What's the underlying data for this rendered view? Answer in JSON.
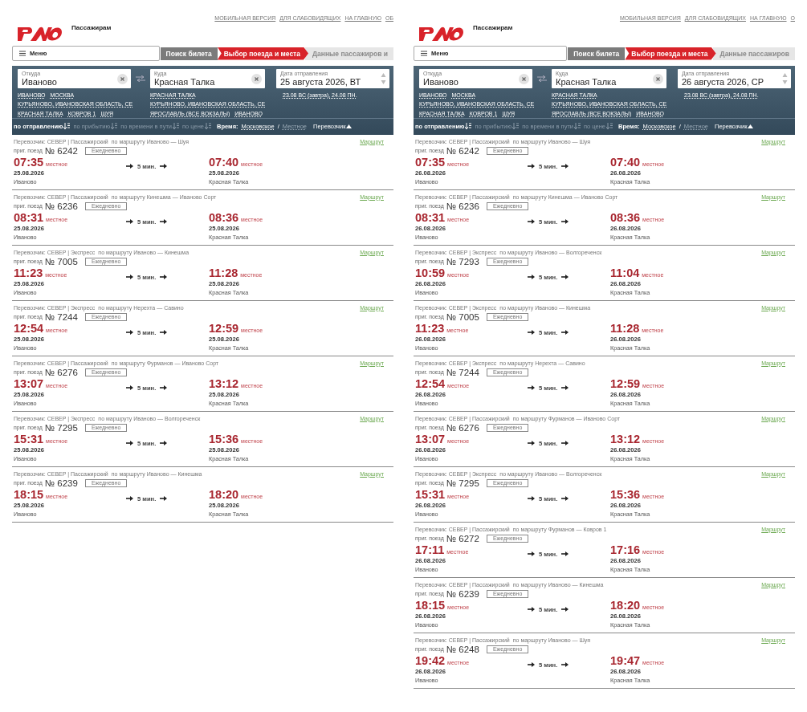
{
  "panels": [
    {
      "header": {
        "section": "Пассажирам",
        "top_links": [
          "МОБИЛЬНАЯ ВЕРСИЯ",
          "ДЛЯ СЛАБОВИДЯЩИХ",
          "НА ГЛАВНУЮ",
          "ОБ"
        ],
        "menu": "Меню",
        "steps": [
          {
            "label": "Поиск билета",
            "completed": true,
            "selected": false
          },
          {
            "label": "Выбор поезда и места",
            "completed": false,
            "selected": true
          },
          {
            "label": "Данные пассажиров и",
            "completed": false,
            "selected": false
          }
        ]
      },
      "search": {
        "from": {
          "label": "Откуда",
          "value": "Иваново"
        },
        "to": {
          "label": "Куда",
          "value": "Красная Талка"
        },
        "date": {
          "label": "Дата отправления",
          "value": "25 августа 2026, ВТ"
        },
        "from_suggestions": [
          "ИВАНОВО",
          "МОСКВА",
          "КУРЬЯНОВО, ИВАНОВСКАЯ ОБЛАСТЬ, СЕ",
          "КРАСНАЯ ТАЛКА",
          "КОВРОВ 1",
          "ШУЯ"
        ],
        "to_suggestions": [
          "КРАСНАЯ ТАЛКА",
          "КУРЬЯНОВО, ИВАНОВСКАЯ ОБЛАСТЬ, СЕ",
          "ЯРОСЛАВЛЬ (ВСЕ ВОКЗАЛЫ)",
          "ИВАНОВО"
        ],
        "date_shortcuts": "23.08 ВС (завтра), 24.08 ПН."
      },
      "sort": {
        "options": [
          {
            "label": "по отправлению",
            "selected": true
          },
          {
            "label": "по прибытию",
            "selected": false
          },
          {
            "label": "по времени в пути",
            "selected": false
          },
          {
            "label": "по цене",
            "selected": false
          }
        ],
        "time_label": "Время:",
        "time_modes": [
          {
            "label": "Московское",
            "selected": true
          },
          {
            "label": "Местное",
            "selected": false
          }
        ],
        "time_separator": "/",
        "carrier_filter": "Перевозчик"
      },
      "trains": [
        {
          "carrier": "Перевозчик: СЕВЕР | Пассажирский",
          "route": "по маршруту Иваново — Шуя",
          "route_link": "Маршрут",
          "train_type": "приг. поезд",
          "number": "№ 6242",
          "schedule": "Ежедневно",
          "departure": {
            "time": "07:35",
            "zone": "местное",
            "date": "25.08.2026",
            "station": "Иваново"
          },
          "duration": "5 мин.",
          "arrival": {
            "time": "07:40",
            "zone": "местное",
            "date": "25.08.2026",
            "station": "Красная Талка"
          }
        },
        {
          "carrier": "Перевозчик: СЕВЕР | Пассажирский",
          "route": "по маршруту Кинешма — Иваново Сорт",
          "route_link": "Маршрут",
          "train_type": "приг. поезд",
          "number": "№ 6236",
          "schedule": "Ежедневно",
          "departure": {
            "time": "08:31",
            "zone": "местное",
            "date": "25.08.2026",
            "station": "Иваново"
          },
          "duration": "5 мин.",
          "arrival": {
            "time": "08:36",
            "zone": "местное",
            "date": "25.08.2026",
            "station": "Красная Талка"
          }
        },
        {
          "carrier": "Перевозчик: СЕВЕР | Экспресс",
          "route": "по маршруту Иваново — Кинешма",
          "route_link": "Маршрут",
          "train_type": "приг. поезд",
          "number": "№ 7005",
          "schedule": "Ежедневно",
          "departure": {
            "time": "11:23",
            "zone": "местное",
            "date": "25.08.2026",
            "station": "Иваново"
          },
          "duration": "5 мин.",
          "arrival": {
            "time": "11:28",
            "zone": "местное",
            "date": "25.08.2026",
            "station": "Красная Талка"
          }
        },
        {
          "carrier": "Перевозчик: СЕВЕР | Экспресс",
          "route": "по маршруту Нерехта — Савино",
          "route_link": "Маршрут",
          "train_type": "приг. поезд",
          "number": "№ 7244",
          "schedule": "Ежедневно",
          "departure": {
            "time": "12:54",
            "zone": "местное",
            "date": "25.08.2026",
            "station": "Иваново"
          },
          "duration": "5 мин.",
          "arrival": {
            "time": "12:59",
            "zone": "местное",
            "date": "25.08.2026",
            "station": "Красная Талка"
          }
        },
        {
          "carrier": "Перевозчик: СЕВЕР | Пассажирский",
          "route": "по маршруту Фурманов — Иваново Сорт",
          "route_link": "Маршрут",
          "train_type": "приг. поезд",
          "number": "№ 6276",
          "schedule": "Ежедневно",
          "departure": {
            "time": "13:07",
            "zone": "местное",
            "date": "25.08.2026",
            "station": "Иваново"
          },
          "duration": "5 мин.",
          "arrival": {
            "time": "13:12",
            "zone": "местное",
            "date": "25.08.2026",
            "station": "Красная Талка"
          }
        },
        {
          "carrier": "Перевозчик: СЕВЕР | Экспресс",
          "route": "по маршруту Иваново — Волгореченск",
          "route_link": "Маршрут",
          "train_type": "приг. поезд",
          "number": "№ 7295",
          "schedule": "Ежедневно",
          "departure": {
            "time": "15:31",
            "zone": "местное",
            "date": "25.08.2026",
            "station": "Иваново"
          },
          "duration": "5 мин.",
          "arrival": {
            "time": "15:36",
            "zone": "местное",
            "date": "25.08.2026",
            "station": "Красная Талка"
          }
        },
        {
          "carrier": "Перевозчик: СЕВЕР | Пассажирский",
          "route": "по маршруту Иваново — Кинешма",
          "route_link": "Маршрут",
          "train_type": "приг. поезд",
          "number": "№ 6239",
          "schedule": "Ежедневно",
          "departure": {
            "time": "18:15",
            "zone": "местное",
            "date": "25.08.2026",
            "station": "Иваново"
          },
          "duration": "5 мин.",
          "arrival": {
            "time": "18:20",
            "zone": "местное",
            "date": "25.08.2026",
            "station": "Красная Талка"
          }
        }
      ]
    },
    {
      "header": {
        "section": "Пассажирам",
        "top_links": [
          "МОБИЛЬНАЯ ВЕРСИЯ",
          "ДЛЯ СЛАБОВИДЯЩИХ",
          "НА ГЛАВНУЮ",
          "О"
        ],
        "menu": "Меню",
        "steps": [
          {
            "label": "Поиск билета",
            "completed": true,
            "selected": false
          },
          {
            "label": "Выбор поезда и места",
            "completed": false,
            "selected": true
          },
          {
            "label": "Данные пассажиров",
            "completed": false,
            "selected": false
          }
        ]
      },
      "search": {
        "from": {
          "label": "Откуда",
          "value": "Иваново"
        },
        "to": {
          "label": "Куда",
          "value": "Красная Талка"
        },
        "date": {
          "label": "Дата отправления",
          "value": "26 августа 2026, СР"
        },
        "from_suggestions": [
          "ИВАНОВО",
          "МОСКВА",
          "КУРЬЯНОВО, ИВАНОВСКАЯ ОБЛАСТЬ, СЕ",
          "КРАСНАЯ ТАЛКА",
          "КОВРОВ 1",
          "ШУЯ"
        ],
        "to_suggestions": [
          "КРАСНАЯ ТАЛКА",
          "КУРЬЯНОВО, ИВАНОВСКАЯ ОБЛАСТЬ, СЕ",
          "ЯРОСЛАВЛЬ (ВСЕ ВОКЗАЛЫ)",
          "ИВАНОВО"
        ],
        "date_shortcuts": "23.08 ВС (завтра), 24.08 ПН."
      },
      "sort": {
        "options": [
          {
            "label": "по отправлению",
            "selected": true
          },
          {
            "label": "по прибытию",
            "selected": false
          },
          {
            "label": "по времени в пути",
            "selected": false
          },
          {
            "label": "по цене",
            "selected": false
          }
        ],
        "time_label": "Время:",
        "time_modes": [
          {
            "label": "Московское",
            "selected": true
          },
          {
            "label": "Местное",
            "selected": false
          }
        ],
        "time_separator": "/",
        "carrier_filter": "Перевозчик"
      },
      "trains": [
        {
          "carrier": "Перевозчик: СЕВЕР | Пассажирский",
          "route": "по маршруту Иваново — Шуя",
          "route_link": "Маршрут",
          "train_type": "приг. поезд",
          "number": "№ 6242",
          "schedule": "Ежедневно",
          "departure": {
            "time": "07:35",
            "zone": "местное",
            "date": "26.08.2026",
            "station": "Иваново"
          },
          "duration": "5 мин.",
          "arrival": {
            "time": "07:40",
            "zone": "местное",
            "date": "26.08.2026",
            "station": "Красная Талка"
          }
        },
        {
          "carrier": "Перевозчик: СЕВЕР | Пассажирский",
          "route": "по маршруту Кинешма — Иваново Сорт",
          "route_link": "Маршрут",
          "train_type": "приг. поезд",
          "number": "№ 6236",
          "schedule": "Ежедневно",
          "departure": {
            "time": "08:31",
            "zone": "местное",
            "date": "26.08.2026",
            "station": "Иваново"
          },
          "duration": "5 мин.",
          "arrival": {
            "time": "08:36",
            "zone": "местное",
            "date": "26.08.2026",
            "station": "Красная Талка"
          }
        },
        {
          "carrier": "Перевозчик: СЕВЕР | Экспресс",
          "route": "по маршруту Иваново — Волгореченск",
          "route_link": "Маршрут",
          "train_type": "приг. поезд",
          "number": "№ 7293",
          "schedule": "Ежедневно",
          "departure": {
            "time": "10:59",
            "zone": "местное",
            "date": "26.08.2026",
            "station": "Иваново"
          },
          "duration": "5 мин.",
          "arrival": {
            "time": "11:04",
            "zone": "местное",
            "date": "26.08.2026",
            "station": "Красная Талка"
          }
        },
        {
          "carrier": "Перевозчик: СЕВЕР | Экспресс",
          "route": "по маршруту Иваново — Кинешма",
          "route_link": "Маршрут",
          "train_type": "приг. поезд",
          "number": "№ 7005",
          "schedule": "Ежедневно",
          "departure": {
            "time": "11:23",
            "zone": "местное",
            "date": "26.08.2026",
            "station": "Иваново"
          },
          "duration": "5 мин.",
          "arrival": {
            "time": "11:28",
            "zone": "местное",
            "date": "26.08.2026",
            "station": "Красная Талка"
          }
        },
        {
          "carrier": "Перевозчик: СЕВЕР | Экспресс",
          "route": "по маршруту Нерехта — Савино",
          "route_link": "Маршрут",
          "train_type": "приг. поезд",
          "number": "№ 7244",
          "schedule": "Ежедневно",
          "departure": {
            "time": "12:54",
            "zone": "местное",
            "date": "26.08.2026",
            "station": "Иваново"
          },
          "duration": "5 мин.",
          "arrival": {
            "time": "12:59",
            "zone": "местное",
            "date": "26.08.2026",
            "station": "Красная Талка"
          }
        },
        {
          "carrier": "Перевозчик: СЕВЕР | Пассажирский",
          "route": "по маршруту Фурманов — Иваново Сорт",
          "route_link": "Маршрут",
          "train_type": "приг. поезд",
          "number": "№ 6276",
          "schedule": "Ежедневно",
          "departure": {
            "time": "13:07",
            "zone": "местное",
            "date": "26.08.2026",
            "station": "Иваново"
          },
          "duration": "5 мин.",
          "arrival": {
            "time": "13:12",
            "zone": "местное",
            "date": "26.08.2026",
            "station": "Красная Талка"
          }
        },
        {
          "carrier": "Перевозчик: СЕВЕР | Экспресс",
          "route": "по маршруту Иваново — Волгореченск",
          "route_link": "Маршрут",
          "train_type": "приг. поезд",
          "number": "№ 7295",
          "schedule": "Ежедневно",
          "departure": {
            "time": "15:31",
            "zone": "местное",
            "date": "26.08.2026",
            "station": "Иваново"
          },
          "duration": "5 мин.",
          "arrival": {
            "time": "15:36",
            "zone": "местное",
            "date": "26.08.2026",
            "station": "Красная Талка"
          }
        },
        {
          "carrier": "Перевозчик: СЕВЕР | Пассажирский",
          "route": "по маршруту Фурманов — Ковров 1",
          "route_link": "Маршрут",
          "train_type": "приг. поезд",
          "number": "№ 6272",
          "schedule": "Ежедневно",
          "departure": {
            "time": "17:11",
            "zone": "местное",
            "date": "26.08.2026",
            "station": "Иваново"
          },
          "duration": "5 мин.",
          "arrival": {
            "time": "17:16",
            "zone": "местное",
            "date": "26.08.2026",
            "station": "Красная Талка"
          }
        },
        {
          "carrier": "Перевозчик: СЕВЕР | Пассажирский",
          "route": "по маршруту Иваново — Кинешма",
          "route_link": "Маршрут",
          "train_type": "приг. поезд",
          "number": "№ 6239",
          "schedule": "Ежедневно",
          "departure": {
            "time": "18:15",
            "zone": "местное",
            "date": "26.08.2026",
            "station": "Иваново"
          },
          "duration": "5 мин.",
          "arrival": {
            "time": "18:20",
            "zone": "местное",
            "date": "26.08.2026",
            "station": "Красная Талка"
          }
        },
        {
          "carrier": "Перевозчик: СЕВЕР | Пассажирский",
          "route": "по маршруту Иваново — Шуя",
          "route_link": "Маршрут",
          "train_type": "приг. поезд",
          "number": "№ 6248",
          "schedule": "Ежедневно",
          "departure": {
            "time": "19:42",
            "zone": "местное",
            "date": "26.08.2026",
            "station": "Иваново"
          },
          "duration": "5 мин.",
          "arrival": {
            "time": "19:47",
            "zone": "местное",
            "date": "26.08.2026",
            "station": "Красная Талка"
          }
        }
      ]
    }
  ]
}
